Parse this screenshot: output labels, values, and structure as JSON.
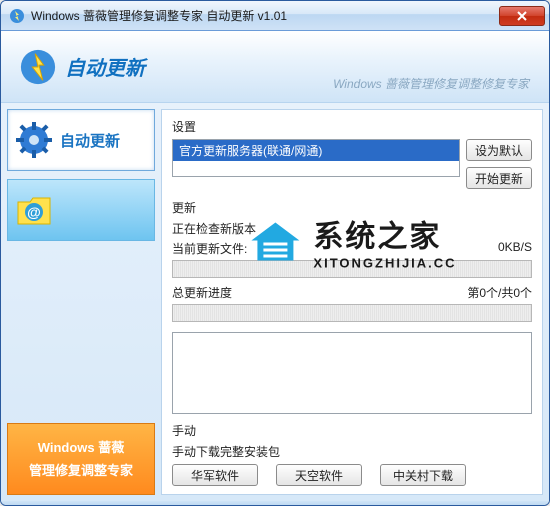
{
  "window": {
    "title": "Windows 蔷薇管理修复调整专家 自动更新 v1.01"
  },
  "header": {
    "title": "自动更新",
    "subtitle": "Windows 蔷薇管理修复调整修复专家"
  },
  "sidebar": {
    "tab_auto_update": "自动更新",
    "banner_line1": "Windows 蔷薇",
    "banner_line2": "管理修复调整专家"
  },
  "settings": {
    "label": "设置",
    "selected_server": "官方更新服务器(联通/网通)",
    "set_default_btn": "设为默认",
    "start_update_btn": "开始更新"
  },
  "update": {
    "label": "更新",
    "checking": "正在检查新版本",
    "current_file_label": "当前更新文件:",
    "speed": "0KB/S",
    "total_progress_label": "总更新进度",
    "total_progress_value": "第0个/共0个"
  },
  "manual": {
    "label": "手动",
    "desc": "手动下载完整安装包",
    "btn_huajun": "华军软件",
    "btn_tiankong": "天空软件",
    "btn_zgc": "中关村下载"
  },
  "watermark": {
    "main": "系统之家",
    "sub": "XITONGZHIJIA.CC"
  }
}
